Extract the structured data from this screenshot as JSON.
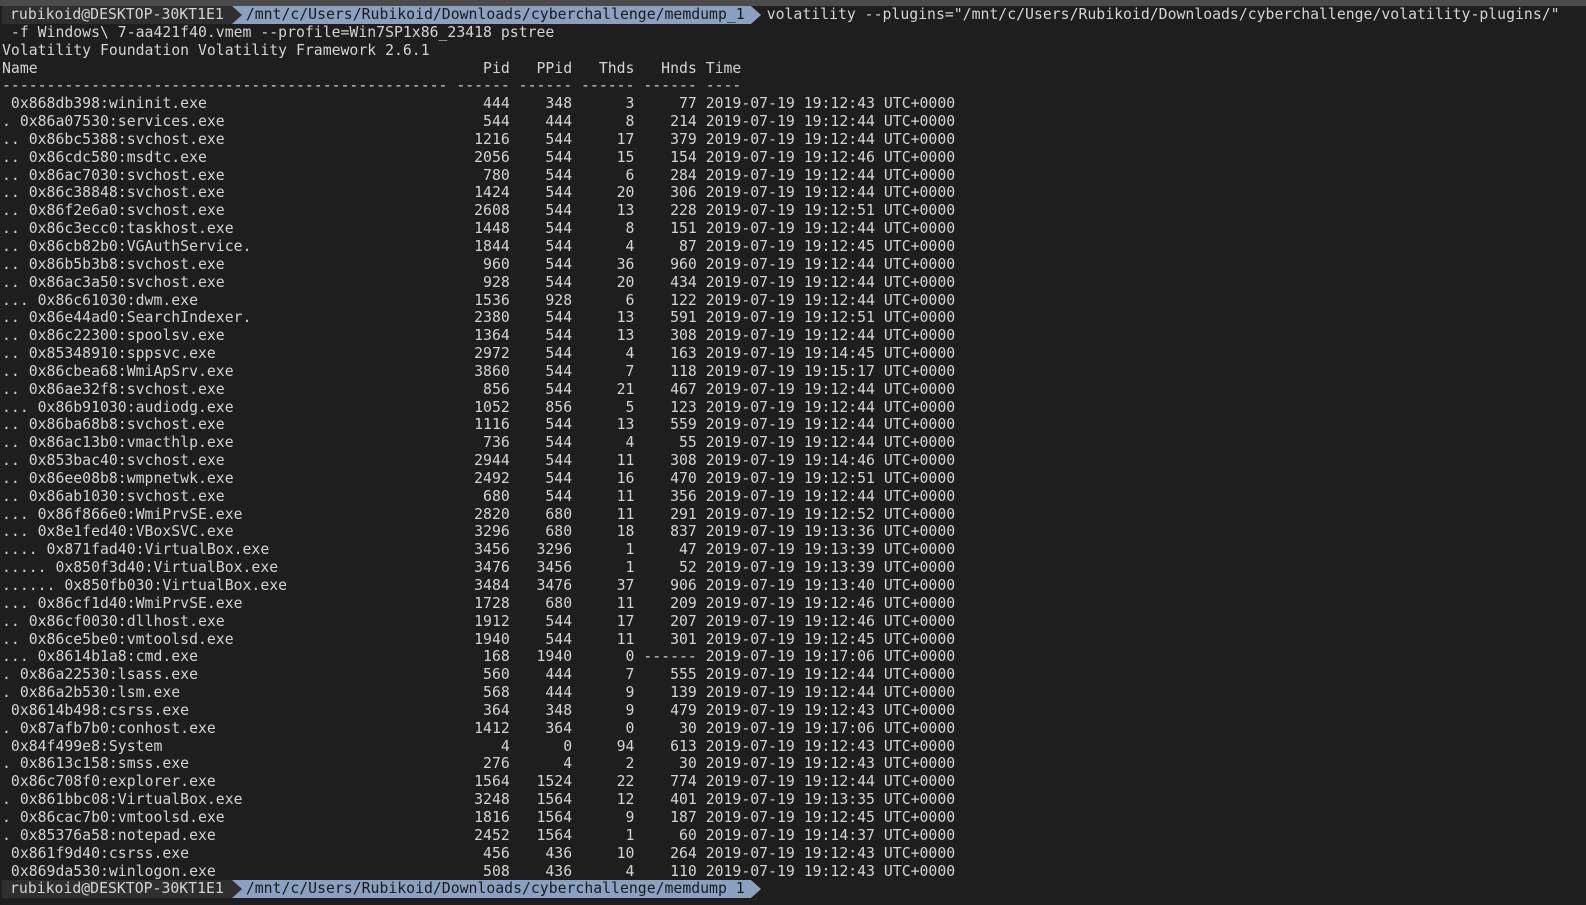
{
  "prompt": {
    "user_host": "rubikoid@DESKTOP-30KT1E1",
    "path": "/mnt/c/Users/Rubikoid/Downloads/cyberchallenge/memdump_1",
    "path_final": "/mnt/c/Users/Rubikoid/Downloads/cyberchallenge/memdump 1",
    "command_line1": "volatility --plugins=\"/mnt/c/Users/Rubikoid/Downloads/cyberchallenge/volatility-plugins/\"",
    "command_line2": " -f Windows\\ 7-aa421f40.vmem --profile=Win7SP1x86_23418 pstree"
  },
  "output": {
    "banner": "Volatility Foundation Volatility Framework 2.6.1",
    "headers": [
      "Name",
      "Pid",
      "PPid",
      "Thds",
      "Hnds",
      "Time"
    ],
    "separators": [
      "--------------------------------------------------",
      "------",
      "------",
      "------",
      "------",
      "----"
    ],
    "rows": [
      [
        " 0x868db398:wininit.exe",
        "444",
        "348",
        "3",
        "77",
        "2019-07-19 19:12:43 UTC+0000"
      ],
      [
        ". 0x86a07530:services.exe",
        "544",
        "444",
        "8",
        "214",
        "2019-07-19 19:12:44 UTC+0000"
      ],
      [
        ".. 0x86bc5388:svchost.exe",
        "1216",
        "544",
        "17",
        "379",
        "2019-07-19 19:12:44 UTC+0000"
      ],
      [
        ".. 0x86cdc580:msdtc.exe",
        "2056",
        "544",
        "15",
        "154",
        "2019-07-19 19:12:46 UTC+0000"
      ],
      [
        ".. 0x86ac7030:svchost.exe",
        "780",
        "544",
        "6",
        "284",
        "2019-07-19 19:12:44 UTC+0000"
      ],
      [
        ".. 0x86c38848:svchost.exe",
        "1424",
        "544",
        "20",
        "306",
        "2019-07-19 19:12:44 UTC+0000"
      ],
      [
        ".. 0x86f2e6a0:svchost.exe",
        "2608",
        "544",
        "13",
        "228",
        "2019-07-19 19:12:51 UTC+0000"
      ],
      [
        ".. 0x86c3ecc0:taskhost.exe",
        "1448",
        "544",
        "8",
        "151",
        "2019-07-19 19:12:44 UTC+0000"
      ],
      [
        ".. 0x86cb82b0:VGAuthService.",
        "1844",
        "544",
        "4",
        "87",
        "2019-07-19 19:12:45 UTC+0000"
      ],
      [
        ".. 0x86b5b3b8:svchost.exe",
        "960",
        "544",
        "36",
        "960",
        "2019-07-19 19:12:44 UTC+0000"
      ],
      [
        ".. 0x86ac3a50:svchost.exe",
        "928",
        "544",
        "20",
        "434",
        "2019-07-19 19:12:44 UTC+0000"
      ],
      [
        "... 0x86c61030:dwm.exe",
        "1536",
        "928",
        "6",
        "122",
        "2019-07-19 19:12:44 UTC+0000"
      ],
      [
        ".. 0x86e44ad0:SearchIndexer.",
        "2380",
        "544",
        "13",
        "591",
        "2019-07-19 19:12:51 UTC+0000"
      ],
      [
        ".. 0x86c22300:spoolsv.exe",
        "1364",
        "544",
        "13",
        "308",
        "2019-07-19 19:12:44 UTC+0000"
      ],
      [
        ".. 0x85348910:sppsvc.exe",
        "2972",
        "544",
        "4",
        "163",
        "2019-07-19 19:14:45 UTC+0000"
      ],
      [
        ".. 0x86cbea68:WmiApSrv.exe",
        "3860",
        "544",
        "7",
        "118",
        "2019-07-19 19:15:17 UTC+0000"
      ],
      [
        ".. 0x86ae32f8:svchost.exe",
        "856",
        "544",
        "21",
        "467",
        "2019-07-19 19:12:44 UTC+0000"
      ],
      [
        "... 0x86b91030:audiodg.exe",
        "1052",
        "856",
        "5",
        "123",
        "2019-07-19 19:12:44 UTC+0000"
      ],
      [
        ".. 0x86ba68b8:svchost.exe",
        "1116",
        "544",
        "13",
        "559",
        "2019-07-19 19:12:44 UTC+0000"
      ],
      [
        ".. 0x86ac13b0:vmacthlp.exe",
        "736",
        "544",
        "4",
        "55",
        "2019-07-19 19:12:44 UTC+0000"
      ],
      [
        ".. 0x853bac40:svchost.exe",
        "2944",
        "544",
        "11",
        "308",
        "2019-07-19 19:14:46 UTC+0000"
      ],
      [
        ".. 0x86ee08b8:wmpnetwk.exe",
        "2492",
        "544",
        "16",
        "470",
        "2019-07-19 19:12:51 UTC+0000"
      ],
      [
        ".. 0x86ab1030:svchost.exe",
        "680",
        "544",
        "11",
        "356",
        "2019-07-19 19:12:44 UTC+0000"
      ],
      [
        "... 0x86f866e0:WmiPrvSE.exe",
        "2820",
        "680",
        "11",
        "291",
        "2019-07-19 19:12:52 UTC+0000"
      ],
      [
        "... 0x8e1fed40:VBoxSVC.exe",
        "3296",
        "680",
        "18",
        "837",
        "2019-07-19 19:13:36 UTC+0000"
      ],
      [
        ".... 0x871fad40:VirtualBox.exe",
        "3456",
        "3296",
        "1",
        "47",
        "2019-07-19 19:13:39 UTC+0000"
      ],
      [
        "..... 0x850f3d40:VirtualBox.exe",
        "3476",
        "3456",
        "1",
        "52",
        "2019-07-19 19:13:39 UTC+0000"
      ],
      [
        "...... 0x850fb030:VirtualBox.exe",
        "3484",
        "3476",
        "37",
        "906",
        "2019-07-19 19:13:40 UTC+0000"
      ],
      [
        "... 0x86cf1d40:WmiPrvSE.exe",
        "1728",
        "680",
        "11",
        "209",
        "2019-07-19 19:12:46 UTC+0000"
      ],
      [
        ".. 0x86cf0030:dllhost.exe",
        "1912",
        "544",
        "17",
        "207",
        "2019-07-19 19:12:46 UTC+0000"
      ],
      [
        ".. 0x86ce5be0:vmtoolsd.exe",
        "1940",
        "544",
        "11",
        "301",
        "2019-07-19 19:12:45 UTC+0000"
      ],
      [
        "... 0x8614b1a8:cmd.exe",
        "168",
        "1940",
        "0",
        "------",
        "2019-07-19 19:17:06 UTC+0000"
      ],
      [
        ". 0x86a22530:lsass.exe",
        "560",
        "444",
        "7",
        "555",
        "2019-07-19 19:12:44 UTC+0000"
      ],
      [
        ". 0x86a2b530:lsm.exe",
        "568",
        "444",
        "9",
        "139",
        "2019-07-19 19:12:44 UTC+0000"
      ],
      [
        " 0x8614b498:csrss.exe",
        "364",
        "348",
        "9",
        "479",
        "2019-07-19 19:12:43 UTC+0000"
      ],
      [
        ". 0x87afb7b0:conhost.exe",
        "1412",
        "364",
        "0",
        "30",
        "2019-07-19 19:17:06 UTC+0000"
      ],
      [
        " 0x84f499e8:System",
        "4",
        "0",
        "94",
        "613",
        "2019-07-19 19:12:43 UTC+0000"
      ],
      [
        ". 0x8613c158:smss.exe",
        "276",
        "4",
        "2",
        "30",
        "2019-07-19 19:12:43 UTC+0000"
      ],
      [
        " 0x86c708f0:explorer.exe",
        "1564",
        "1524",
        "22",
        "774",
        "2019-07-19 19:12:44 UTC+0000"
      ],
      [
        ". 0x861bbc08:VirtualBox.exe",
        "3248",
        "1564",
        "12",
        "401",
        "2019-07-19 19:13:35 UTC+0000"
      ],
      [
        ". 0x86cac7b0:vmtoolsd.exe",
        "1816",
        "1564",
        "9",
        "187",
        "2019-07-19 19:12:45 UTC+0000"
      ],
      [
        ". 0x85376a58:notepad.exe",
        "2452",
        "1564",
        "1",
        "60",
        "2019-07-19 19:14:37 UTC+0000"
      ],
      [
        " 0x861f9d40:csrss.exe",
        "456",
        "436",
        "10",
        "264",
        "2019-07-19 19:12:43 UTC+0000"
      ],
      [
        " 0x869da530:winlogon.exe",
        "508",
        "436",
        "4",
        "110",
        "2019-07-19 19:12:43 UTC+0000"
      ]
    ]
  }
}
